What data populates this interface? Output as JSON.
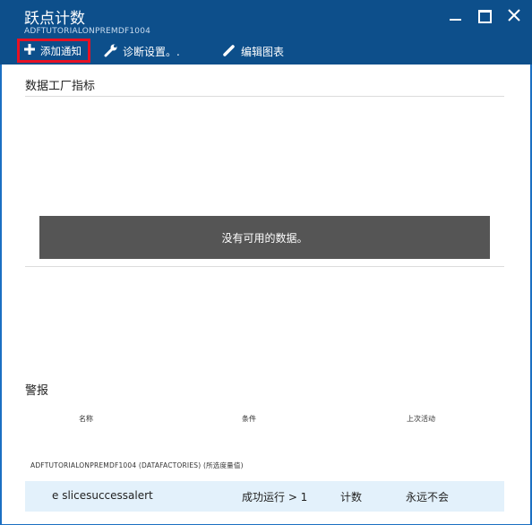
{
  "header": {
    "title": "跃点计数",
    "subtitle": "ADFTUTORIALONPREMDF1004"
  },
  "toolbar": {
    "add_alert_label": "添加通知",
    "diagnostics_label": "诊断设置。.",
    "edit_chart_label": "编辑图表"
  },
  "metrics": {
    "title": "数据工厂指标",
    "no_data": "没有可用的数据。"
  },
  "alerts": {
    "title": "警报",
    "columns": [
      "名称",
      "条件",
      "上次活动"
    ],
    "group_label": "ADFTUTORIALONPREMDF1004 (DATAFACTORIES) (所选度量值)",
    "rows": [
      {
        "name": "e slicesuccessalert",
        "condition": "成功运行 > 1",
        "aggregation": "计数",
        "last_active": "永远不会"
      }
    ]
  },
  "colors": {
    "header_bg": "#0d4f8b",
    "highlight_border": "#e81123",
    "no_data_bg": "#555555",
    "row_bg": "#e3f1fb"
  },
  "icons": [
    "plus-icon",
    "wrench-icon",
    "pencil-icon",
    "minimize-icon",
    "maximize-icon",
    "close-icon"
  ]
}
